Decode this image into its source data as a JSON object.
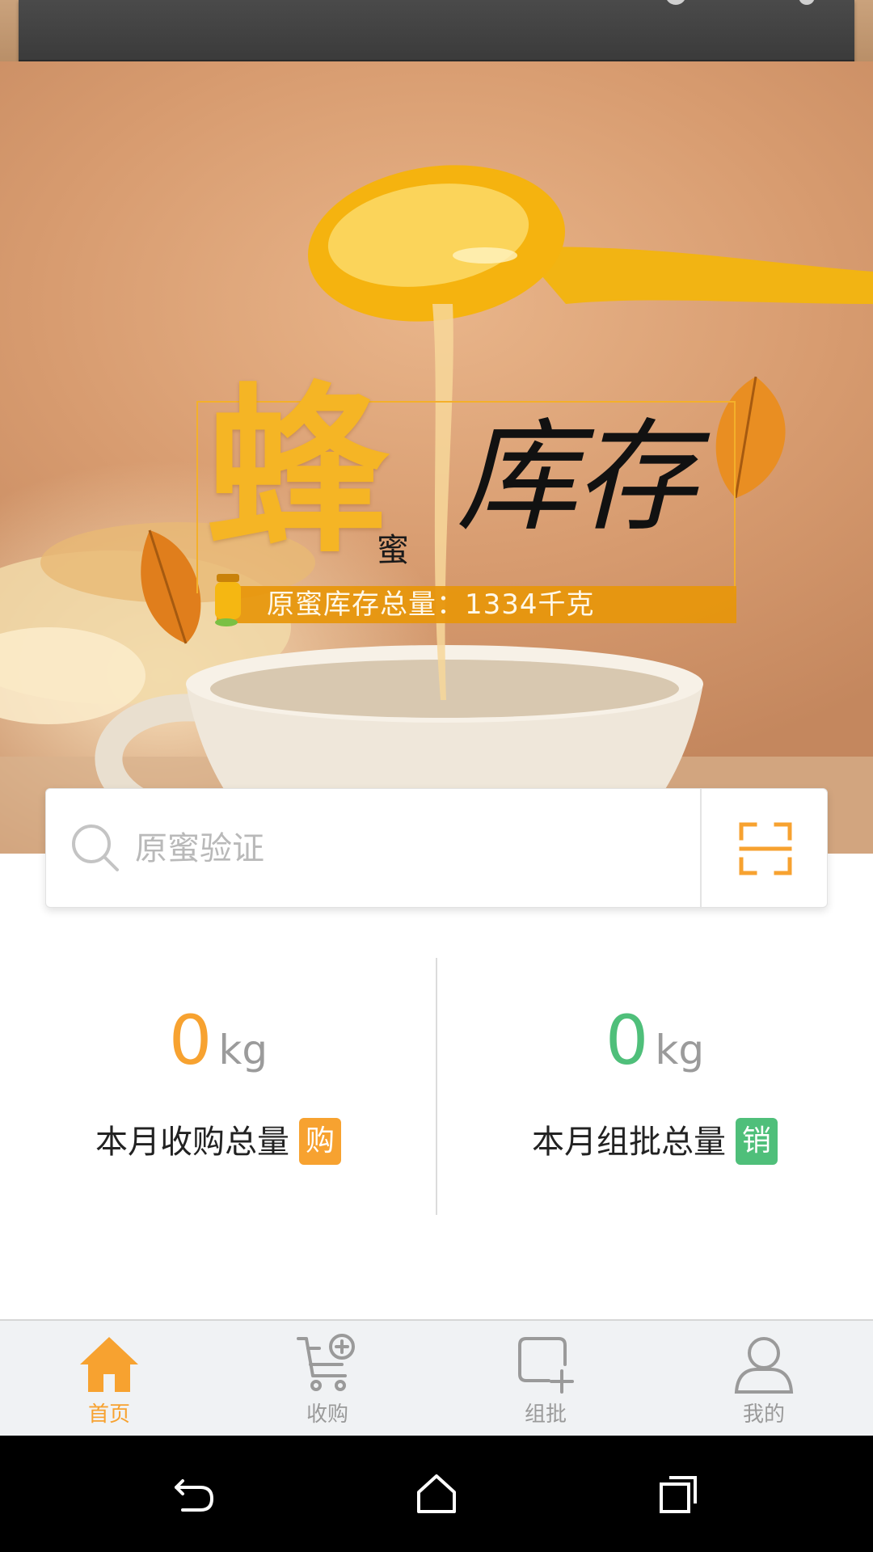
{
  "banner": {
    "char_big": "蜂",
    "char_small": "蜜",
    "char_title": "库存",
    "stock_label": "原蜜库存总量：",
    "stock_value": "1334",
    "stock_unit": "千克"
  },
  "search": {
    "placeholder": "原蜜验证",
    "value": ""
  },
  "stats": {
    "purchase": {
      "value": "0",
      "unit": "kg",
      "label": "本月收购总量",
      "badge": "购",
      "color": "#f7a230"
    },
    "wholesale": {
      "value": "0",
      "unit": "kg",
      "label": "本月组批总量",
      "badge": "销",
      "color": "#4fbf7a"
    }
  },
  "bottom_nav": {
    "items": [
      {
        "label": "首页",
        "icon": "home-icon",
        "active": true
      },
      {
        "label": "收购",
        "icon": "cart-add-icon",
        "active": false
      },
      {
        "label": "组批",
        "icon": "batch-add-icon",
        "active": false
      },
      {
        "label": "我的",
        "icon": "user-icon",
        "active": false
      }
    ],
    "active_color": "#f7a230",
    "inactive_color": "#9a9a9a"
  },
  "system_nav": {
    "icons": [
      "back-icon",
      "home-outline-icon",
      "recents-icon"
    ]
  }
}
